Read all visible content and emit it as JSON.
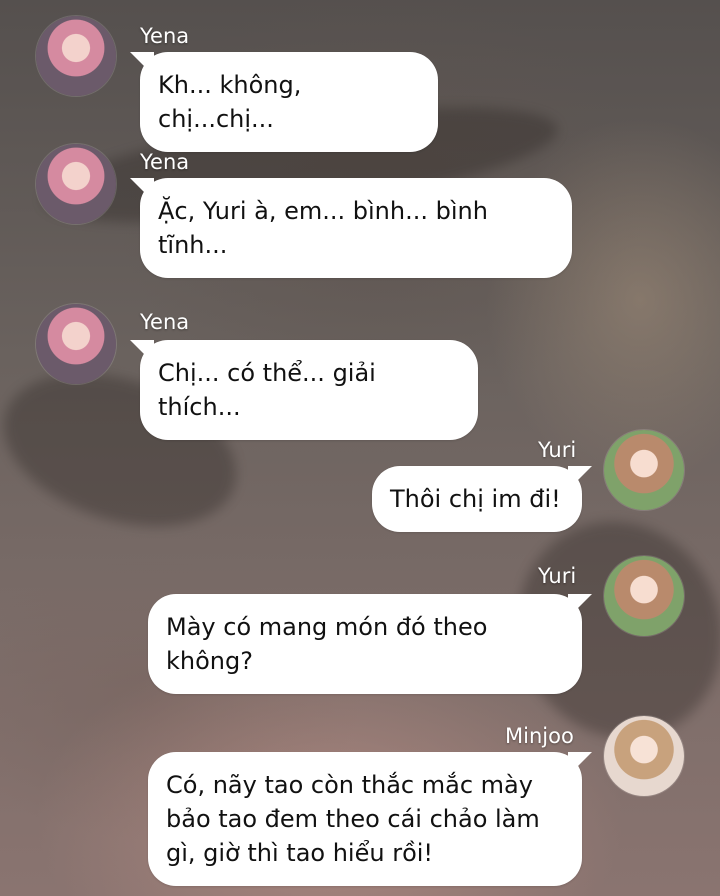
{
  "messages": [
    {
      "sender": "Yena",
      "side": "left",
      "text": "Kh... không, chị...chị..."
    },
    {
      "sender": "Yena",
      "side": "left",
      "text": "Ặc, Yuri à, em... bình... bình tĩnh..."
    },
    {
      "sender": "Yena",
      "side": "left",
      "text": "Chị... có thể... giải thích..."
    },
    {
      "sender": "Yuri",
      "side": "right",
      "text": "Thôi chị im đi!"
    },
    {
      "sender": "Yuri",
      "side": "right",
      "text": "Mày có mang món đó theo không?"
    },
    {
      "sender": "Minjoo",
      "side": "right",
      "text": "Có, nãy tao còn thắc mắc mày bảo tao đem theo cái chảo làm gì, giờ thì tao hiểu rồi!"
    }
  ]
}
